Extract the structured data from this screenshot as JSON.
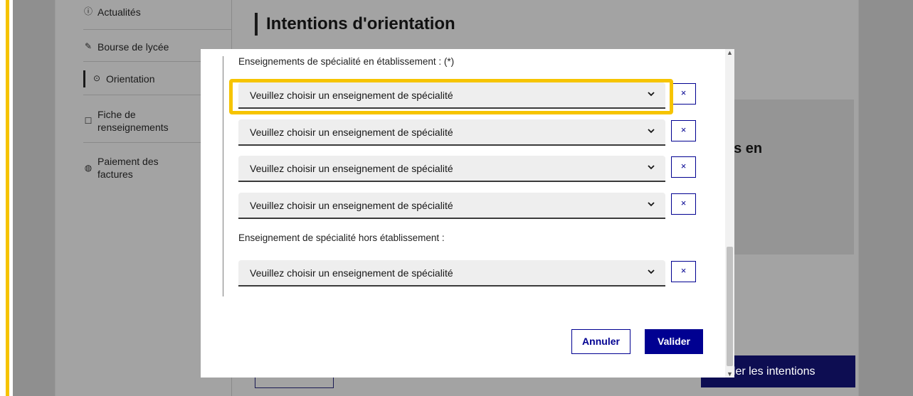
{
  "sidebar": {
    "items": [
      {
        "icon": "info-icon",
        "label": "Actualités"
      },
      {
        "icon": "scholarship-icon",
        "label": "Bourse de lycée"
      },
      {
        "icon": "compass-icon",
        "label": "Orientation"
      },
      {
        "icon": "edit-icon",
        "label": "Fiche de renseignements"
      },
      {
        "icon": "payment-icon",
        "label": "Paiement des factures"
      }
    ],
    "active_index": 2
  },
  "page": {
    "title": "Intentions d'orientation",
    "card_text_fragment": "es en",
    "cta_fragment": "ider les intentions"
  },
  "modal": {
    "section_in_establishment": "Enseignements de spécialité en établissement : (*)",
    "section_out_establishment": "Enseignement de spécialité hors établissement :",
    "select_placeholder": "Veuillez choisir un enseignement de spécialité",
    "remove_label": "×",
    "cancel_label": "Annuler",
    "submit_label": "Valider"
  },
  "colors": {
    "accent_yellow": "#f6c400",
    "brand_blue": "#000091"
  }
}
